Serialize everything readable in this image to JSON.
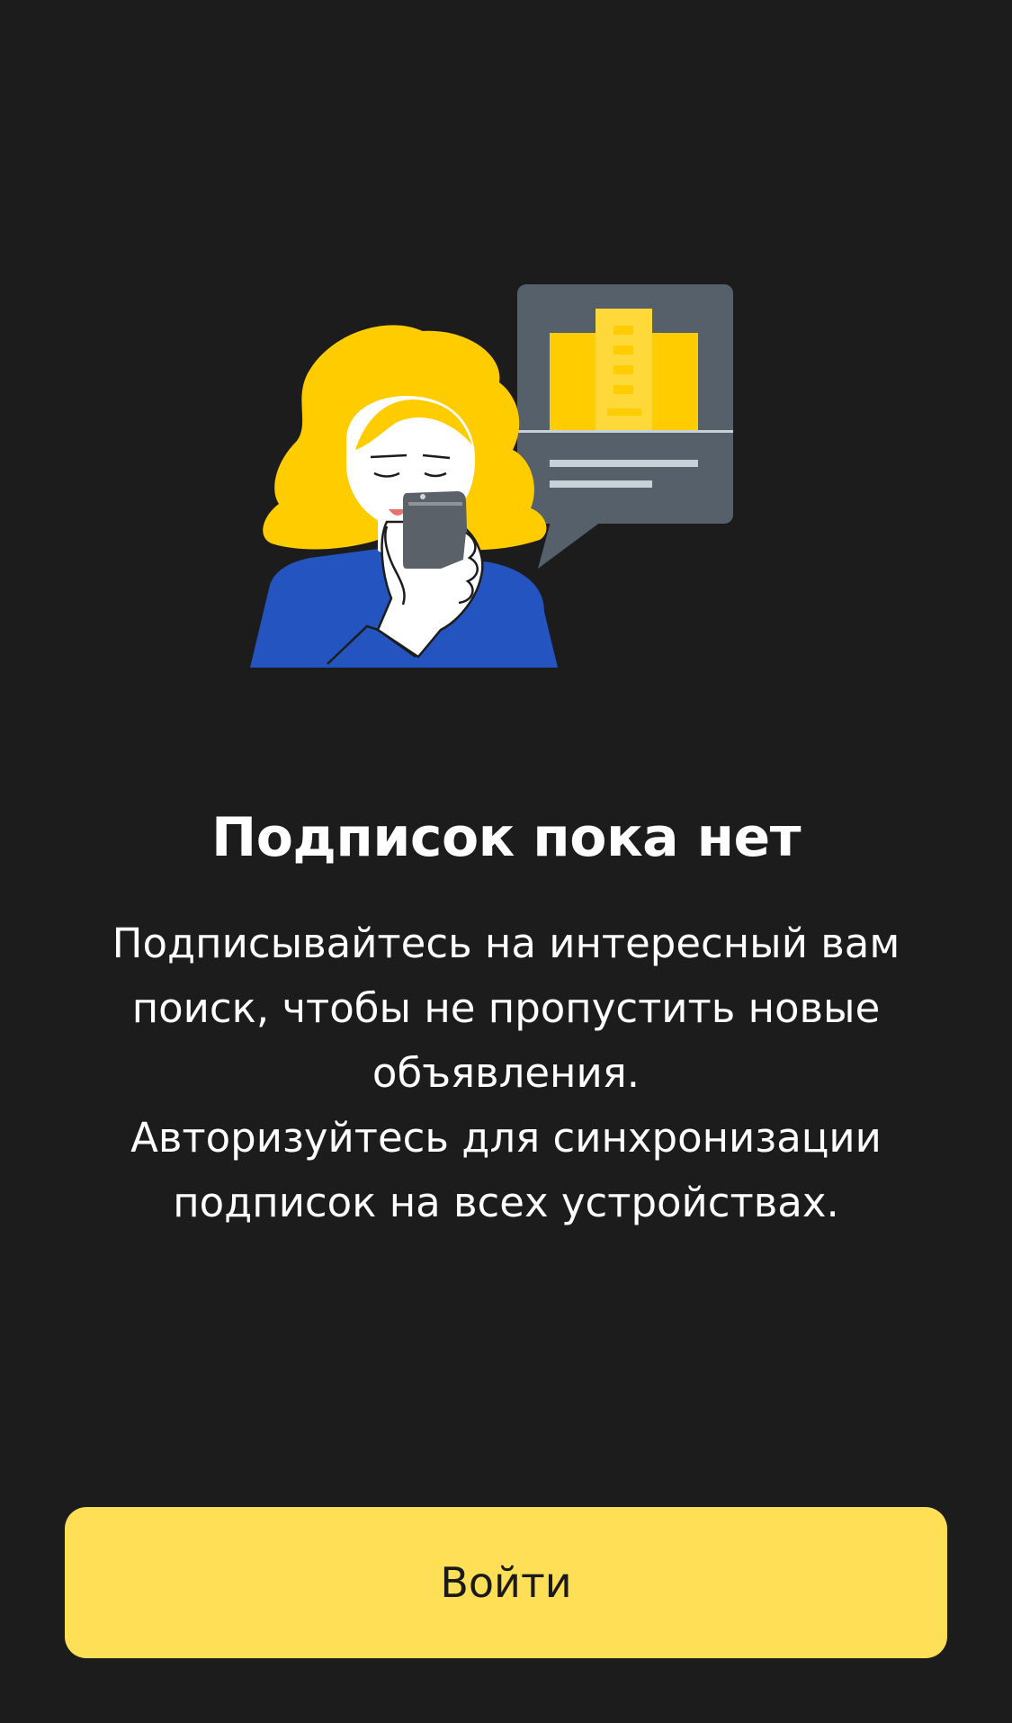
{
  "empty_state": {
    "illustration_icon": "woman-reading-phone-illustration",
    "title": "Подписок пока нет",
    "description_lines": [
      "Подписывайтесь на интересный вам поиск, чтобы не пропустить новые объявления.",
      "Авторизуйтесь для синхронизации подписок на всех устройствах."
    ]
  },
  "actions": {
    "login_label": "Войти"
  },
  "colors": {
    "background": "#1c1c1c",
    "accent": "#ffdf55",
    "hair": "#ffcc00",
    "shirt": "#2454c0",
    "bubble": "#56606a"
  }
}
